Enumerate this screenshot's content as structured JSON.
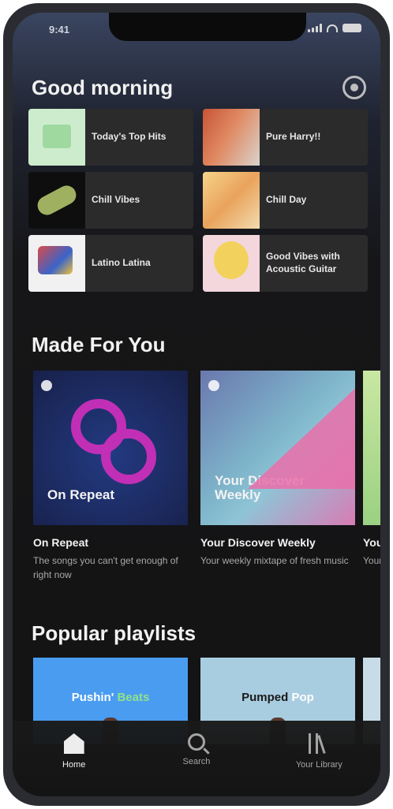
{
  "status_bar": {
    "time": "9:41"
  },
  "home": {
    "greeting": "Good morning",
    "quick_items": [
      {
        "label": "Today's Top Hits",
        "art": "art-tophits"
      },
      {
        "label": "Pure Harry!!",
        "art": "art-harr"
      },
      {
        "label": "Chill Vibes",
        "art": "art-chill"
      },
      {
        "label": "Chill Day",
        "art": "art-chill2"
      },
      {
        "label": "Latino Latina",
        "art": "art-latino"
      },
      {
        "label": "Good Vibes with Acoustic Guitar",
        "art": "art-acoustic"
      }
    ]
  },
  "made_for_you": {
    "title": "Made For You",
    "cards": [
      {
        "art_text": "On Repeat",
        "title": "On Repeat",
        "subtitle": "The songs you can't get enough of right now"
      },
      {
        "art_text": "Your Discover Weekly",
        "title": "Your Discover Weekly",
        "subtitle": "Your weekly mixtape of fresh music"
      },
      {
        "art_text": "",
        "title": "Your",
        "subtitle": "Your"
      }
    ]
  },
  "popular_playlists": {
    "title": "Popular playlists",
    "cards": [
      {
        "label_a": "Pushin'",
        "label_b": "Beats",
        "color_b": "#8fe28a"
      },
      {
        "label_a": "Pumped",
        "label_b": "Pop",
        "color_b": "#ffffff"
      },
      {
        "label_a": "",
        "label_b": "",
        "color_b": "#ffffff"
      }
    ]
  },
  "bottom_nav": {
    "items": [
      {
        "label": "Home",
        "icon": "home-icon",
        "active": true
      },
      {
        "label": "Search",
        "icon": "search-icon",
        "active": false
      },
      {
        "label": "Your Library",
        "icon": "library-icon",
        "active": false
      }
    ]
  },
  "colors": {
    "background": "#131313",
    "accent_pink": "#c12fb6",
    "card_bg": "#2b2b2c"
  }
}
